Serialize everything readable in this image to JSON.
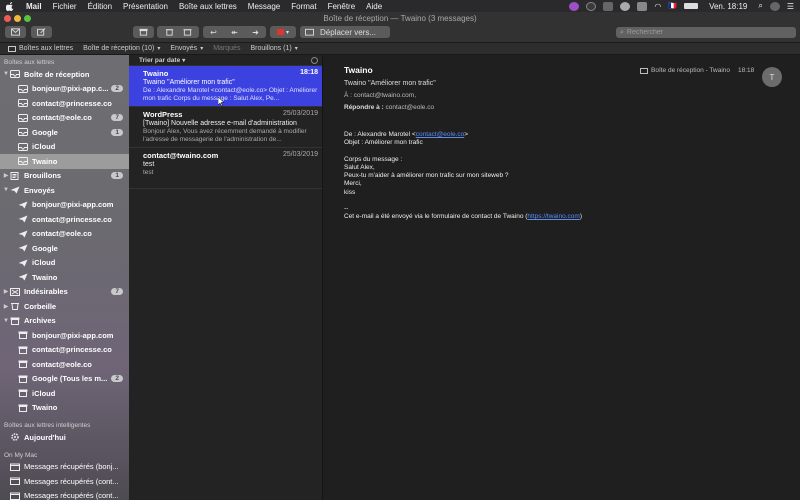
{
  "menubar": {
    "menus": [
      "Mail",
      "Fichier",
      "Édition",
      "Présentation",
      "Boîte aux lettres",
      "Message",
      "Format",
      "Fenêtre",
      "Aide"
    ],
    "clock": "Ven. 18:19",
    "flag": "🇫🇷"
  },
  "window": {
    "title": "Boîte de réception — Twaino (3 messages)"
  },
  "toolbar": {
    "move_label": "Déplacer vers...",
    "search_placeholder": "Rechercher"
  },
  "favorites": {
    "mailboxes": "Boîtes aux lettres",
    "inbox": "Boîte de réception (10)",
    "sent": "Envoyés",
    "flagged": "Marqués",
    "drafts": "Brouillons (1)"
  },
  "sidebar": {
    "section_mailboxes": "Boîtes aux lettres",
    "section_smart": "Boîtes aux lettres intelligentes",
    "section_onmymac": "On My Mac",
    "items": [
      {
        "label": "Boîte de réception",
        "level": 1,
        "icon": "inbox-icon",
        "count": "",
        "disclosure": "▼"
      },
      {
        "label": "bonjour@pixi-app.c...",
        "level": 2,
        "icon": "inbox-icon",
        "count": "2",
        "disclosure": ""
      },
      {
        "label": "contact@princesse.co",
        "level": 2,
        "icon": "inbox-icon",
        "count": "",
        "disclosure": ""
      },
      {
        "label": "contact@eole.co",
        "level": 2,
        "icon": "inbox-icon",
        "count": "7",
        "disclosure": ""
      },
      {
        "label": "Google",
        "level": 2,
        "icon": "inbox-icon",
        "count": "1",
        "disclosure": ""
      },
      {
        "label": "iCloud",
        "level": 2,
        "icon": "inbox-icon",
        "count": "",
        "disclosure": ""
      },
      {
        "label": "Twaino",
        "level": 2,
        "icon": "inbox-icon",
        "count": "",
        "disclosure": ""
      },
      {
        "label": "Brouillons",
        "level": 1,
        "icon": "draft-icon",
        "count": "1",
        "disclosure": "▶"
      },
      {
        "label": "Envoyés",
        "level": 1,
        "icon": "sent-icon",
        "count": "",
        "disclosure": "▼"
      },
      {
        "label": "bonjour@pixi-app.com",
        "level": 2,
        "icon": "sent-icon",
        "count": "",
        "disclosure": ""
      },
      {
        "label": "contact@princesse.co",
        "level": 2,
        "icon": "sent-icon",
        "count": "",
        "disclosure": ""
      },
      {
        "label": "contact@eole.co",
        "level": 2,
        "icon": "sent-icon",
        "count": "",
        "disclosure": ""
      },
      {
        "label": "Google",
        "level": 2,
        "icon": "sent-icon",
        "count": "",
        "disclosure": ""
      },
      {
        "label": "iCloud",
        "level": 2,
        "icon": "sent-icon",
        "count": "",
        "disclosure": ""
      },
      {
        "label": "Twaino",
        "level": 2,
        "icon": "sent-icon",
        "count": "",
        "disclosure": ""
      },
      {
        "label": "Indésirables",
        "level": 1,
        "icon": "junk-icon",
        "count": "7",
        "disclosure": "▶"
      },
      {
        "label": "Corbeille",
        "level": 1,
        "icon": "trash-icon",
        "count": "",
        "disclosure": "▶"
      },
      {
        "label": "Archives",
        "level": 1,
        "icon": "archive-icon",
        "count": "",
        "disclosure": "▼"
      },
      {
        "label": "bonjour@pixi-app.com",
        "level": 2,
        "icon": "archive-icon",
        "count": "",
        "disclosure": ""
      },
      {
        "label": "contact@princesse.co",
        "level": 2,
        "icon": "archive-icon",
        "count": "",
        "disclosure": ""
      },
      {
        "label": "contact@eole.co",
        "level": 2,
        "icon": "archive-icon",
        "count": "",
        "disclosure": ""
      },
      {
        "label": "Google (Tous les m...",
        "level": 2,
        "icon": "archive-icon",
        "count": "2",
        "disclosure": ""
      },
      {
        "label": "iCloud",
        "level": 2,
        "icon": "archive-icon",
        "count": "",
        "disclosure": ""
      },
      {
        "label": "Twaino",
        "level": 2,
        "icon": "archive-icon",
        "count": "",
        "disclosure": ""
      }
    ],
    "smart": [
      {
        "label": "Aujourd'hui",
        "icon": "gear-icon"
      }
    ],
    "onmymac": [
      {
        "label": "Messages récupérés (bonj..."
      },
      {
        "label": "Messages récupérés (cont..."
      },
      {
        "label": "Messages récupérés (cont..."
      }
    ]
  },
  "list": {
    "sort_label": "Trier par date",
    "messages": [
      {
        "from": "Twaino",
        "date": "18:18",
        "subject": "Twaino \"Améliorer mon trafic\"",
        "preview": "De : Alexandre Marotel <contact@eole.co> Objet : Améliorer mon trafic Corps du message : Salut Alex, Pe..."
      },
      {
        "from": "WordPress",
        "date": "25/03/2019",
        "subject": "[Twaino] Nouvelle adresse e-mail d'administration",
        "preview": "Bonjour Alex, Vous avez récemment demandé à modifier l'adresse de messagerie de l'administration de..."
      },
      {
        "from": "contact@twaino.com",
        "date": "25/03/2019",
        "subject": "test",
        "preview": "test"
      }
    ]
  },
  "reader": {
    "from": "Twaino",
    "subject": "Twaino \"Améliorer mon trafic\"",
    "to_label": "À :",
    "to": "contact@twaino.com,",
    "reply_label": "Répondre à :",
    "reply": "contact@eole.co",
    "folder": "Boîte de réception - Twaino",
    "time": "18:18",
    "avatar": "T",
    "body": {
      "line1_prefix": "De : Alexandre Marotel <",
      "line1_link": "contact@eole.co",
      "line1_suffix": ">",
      "line2": "Objet : Améliorer mon trafic",
      "line3": "Corps du message :",
      "line4": "Salut Alex,",
      "line5": "Peux-tu m'aider à améliorer mon trafic sur mon siteweb ?",
      "line6": "Merci,",
      "line7": "kiss",
      "line8": "--",
      "line9_prefix": "Cet e-mail a été envoyé via le formulaire de contact de Twaino (",
      "line9_link": "https://twaino.com",
      "line9_suffix": ")"
    }
  },
  "colors": {
    "accent": "#3b42e0",
    "sidebar": "#6e6e72",
    "link": "#5b8ef3"
  }
}
